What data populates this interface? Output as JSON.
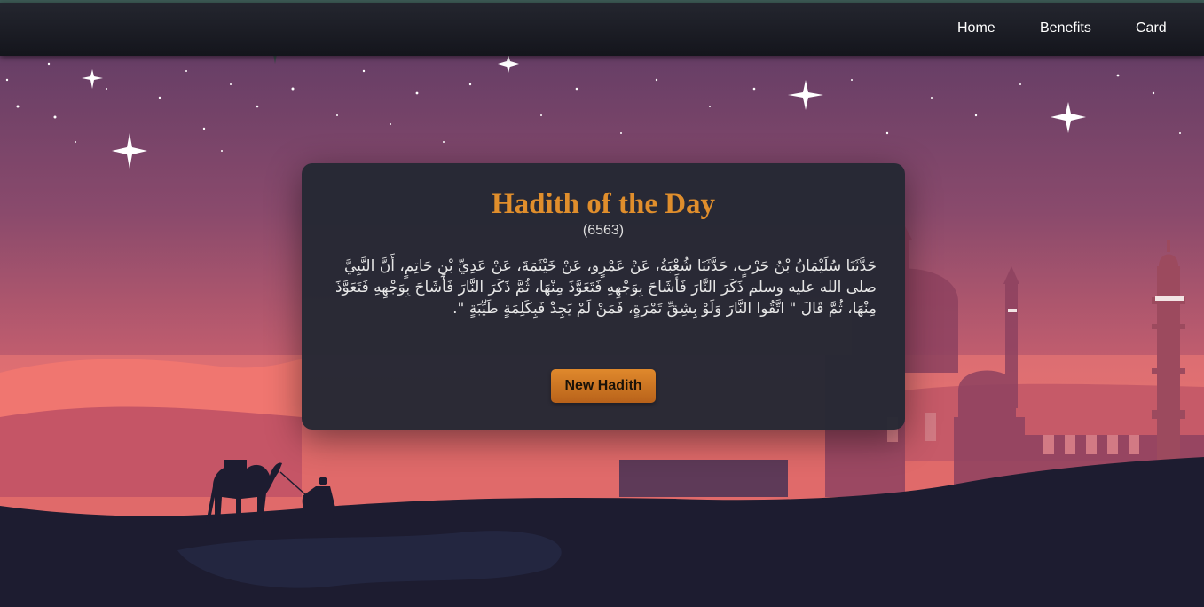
{
  "nav": {
    "home": "Home",
    "benefits": "Benefits",
    "card": "Card"
  },
  "hadith": {
    "title": "Hadith of the Day",
    "number": "(6563)",
    "text": "حَدَّثَنَا سُلَيْمَانُ بْنُ حَرْبٍ، حَدَّثَنَا شُعْبَةُ، عَنْ عَمْرٍو، عَنْ خَيْثَمَةَ، عَنْ عَدِيِّ بْنِ حَاتِمٍ، أَنَّ النَّبِيَّ صلى الله عليه وسلم ذَكَرَ النَّارَ فَأَشَاحَ بِوَجْهِهِ فَتَعَوَّذَ مِنْهَا، ثُمَّ ذَكَرَ النَّارَ فَأَشَاحَ بِوَجْهِهِ فَتَعَوَّذَ مِنْهَا، ثُمَّ قَالَ \" اتَّقُوا النَّارَ وَلَوْ بِشِقِّ تَمْرَةٍ، فَمَنْ لَمْ يَجِدْ فَبِكَلِمَةٍ طَيِّبَةٍ \".",
    "button_label": "New Hadith"
  },
  "colors": {
    "title": "#e08e2c",
    "button": "#d07a22",
    "card_bg": "#252834",
    "sky_top": "#5a3a64",
    "sky_bottom": "#e06a6a"
  },
  "icons": [
    "star-icon",
    "camel-silhouette",
    "traveler-silhouette",
    "mosque-silhouette",
    "minaret-silhouette"
  ]
}
